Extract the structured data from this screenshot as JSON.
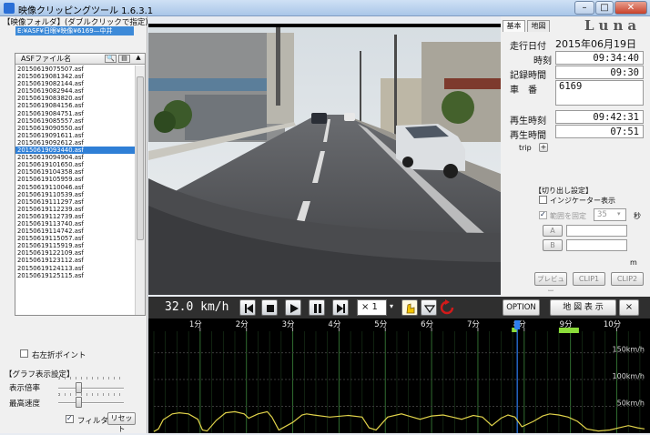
{
  "window": {
    "title": "映像クリッピングツール  1.6.3.1",
    "minimize": "–",
    "maximize": "□",
    "close": "✕"
  },
  "left_panel": {
    "folder_label": "【映像フォルダ】(ダブルクリックで指定)",
    "folder_path": "E:¥ASF¥日眼¥映像¥6169—中井",
    "list_header": "ASFファイル名",
    "files": [
      "20150619075507.asf",
      "20150619081342.asf",
      "20150619082144.asf",
      "20150619082944.asf",
      "20150619083820.asf",
      "20150619084156.asf",
      "20150619084751.asf",
      "20150619085557.asf",
      "20150619090550.asf",
      "20150619091611.asf",
      "20150619092612.asf",
      "20150619093440.asf",
      "20150619094904.asf",
      "20150619101650.asf",
      "20150619104358.asf",
      "20150619105959.asf",
      "20150619110046.asf",
      "20150619110539.asf",
      "20150619111297.asf",
      "20150619112239.asf",
      "20150619112739.asf",
      "20150619113740.asf",
      "20150619114742.asf",
      "20150619115057.asf",
      "20150619115919.asf",
      "20150619122109.asf",
      "20150619123112.asf",
      "20150619124113.asf",
      "20150619125115.asf"
    ],
    "selected_index": 11,
    "left_right_point_label": "右左折ポイント",
    "graph_settings_label": "【グラフ表示設定】",
    "display_rate_label": "表示倍率",
    "max_speed_label": "最高速度",
    "display_rate": 0.3,
    "max_speed": 0.3,
    "filter_label": "フィルター",
    "reset_label": "リセット"
  },
  "right_panel": {
    "tab_basic": "基本",
    "tab_map": "地図",
    "brand": "Luna",
    "drive_date_label": "走行日付",
    "drive_date": "2015年06月19日",
    "time_label": "時刻",
    "time": "09:34:40",
    "rec_time_label": "記録時間",
    "rec_time": "09:30",
    "vehicle_label": "車　番",
    "vehicle": "6169",
    "play_time_label": "再生時刻",
    "play_time": "09:42:31",
    "play_duration_label": "再生時間",
    "play_duration": "07:51",
    "trip_label": "trip",
    "trip_btn": "+",
    "clip_settings_label": "【切り出し設定】",
    "indicator_label": "インジケーター表示",
    "fixed_range_label": "範囲を固定",
    "fixed_range_value": "35",
    "seconds_label": "秒",
    "a_label": "A",
    "b_label": "B",
    "m_label": "m",
    "preview_btn": "プレビュー",
    "clip1_btn": "CLIP1",
    "clip2_btn": "CLIP2"
  },
  "controls": {
    "speed": "32.0 km/h",
    "rate": "× 1",
    "option_btn": "OPTION",
    "map_btn": "地 図 表 示",
    "close_btn": "×"
  },
  "chart_data": {
    "type": "line",
    "x_ticks": [
      "1分",
      "2分",
      "3分",
      "4分",
      "5分",
      "6分",
      "7分",
      "8分",
      "9分",
      "10分"
    ],
    "y_ticks": [
      "150km/h",
      "100km/h",
      "50km/h"
    ],
    "y_tick_values": [
      150,
      100,
      50
    ],
    "ylim": [
      0,
      190
    ],
    "xlim": [
      0,
      10.6
    ],
    "current_position_min": 7.85,
    "grid": true,
    "series": [
      {
        "color": "#e0d24a",
        "x": [
          0,
          0.1,
          0.2,
          0.4,
          0.55,
          0.75,
          0.95,
          1.05,
          1.15,
          1.35,
          1.55,
          1.75,
          1.95,
          2.05,
          2.25,
          2.45,
          2.55,
          2.7,
          3.0,
          3.2,
          3.3,
          3.45,
          3.8,
          4.2,
          4.5,
          4.65,
          4.8,
          5.05,
          5.35,
          5.5,
          5.75,
          6.0,
          6.25,
          6.45,
          6.65,
          6.9,
          7.1,
          7.3,
          7.5,
          7.65,
          7.8,
          7.95,
          8.2,
          8.4,
          8.55,
          8.75,
          8.95,
          9.15,
          9.35,
          9.6,
          9.85,
          10.05,
          10.25,
          10.45,
          10.6
        ],
        "values": [
          3,
          8,
          25,
          36,
          38,
          36,
          26,
          6,
          4,
          24,
          38,
          40,
          36,
          28,
          36,
          40,
          30,
          6,
          20,
          34,
          36,
          34,
          30,
          33,
          30,
          10,
          6,
          30,
          36,
          32,
          26,
          32,
          34,
          30,
          26,
          33,
          30,
          14,
          28,
          34,
          30,
          12,
          22,
          32,
          36,
          34,
          30,
          22,
          8,
          4,
          6,
          10,
          14,
          10,
          8
        ]
      }
    ]
  }
}
